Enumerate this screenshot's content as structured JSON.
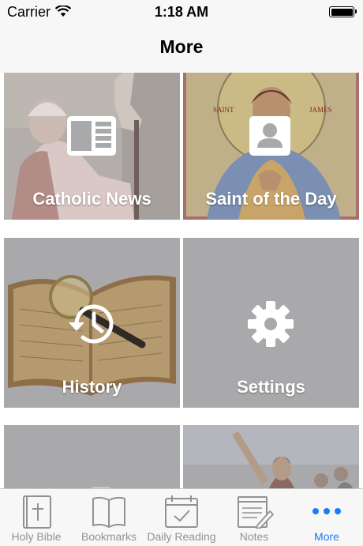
{
  "status_bar": {
    "carrier": "Carrier",
    "time": "1:18 AM"
  },
  "nav": {
    "title": "More"
  },
  "tiles": [
    {
      "label": "Catholic News",
      "icon": "news-icon"
    },
    {
      "label": "Saint of the Day",
      "icon": "person-icon",
      "image_text": [
        "SAINT",
        "JAMES"
      ]
    },
    {
      "label": "History",
      "icon": "history-icon"
    },
    {
      "label": "Settings",
      "icon": "gear-icon"
    },
    {
      "label": "",
      "icon": ""
    },
    {
      "label": "",
      "icon": ""
    }
  ],
  "tabbar": {
    "items": [
      {
        "label": "Holy Bible",
        "icon": "bible-icon"
      },
      {
        "label": "Bookmarks",
        "icon": "book-icon"
      },
      {
        "label": "Daily Reading",
        "icon": "calendar-check-icon"
      },
      {
        "label": "Notes",
        "icon": "notes-icon"
      },
      {
        "label": "More",
        "icon": "more-dots-icon"
      }
    ],
    "active_index": 4
  },
  "colors": {
    "accent": "#1a7cf5",
    "tile_bg": "#a9a9ab",
    "inactive_tab": "#929292"
  }
}
